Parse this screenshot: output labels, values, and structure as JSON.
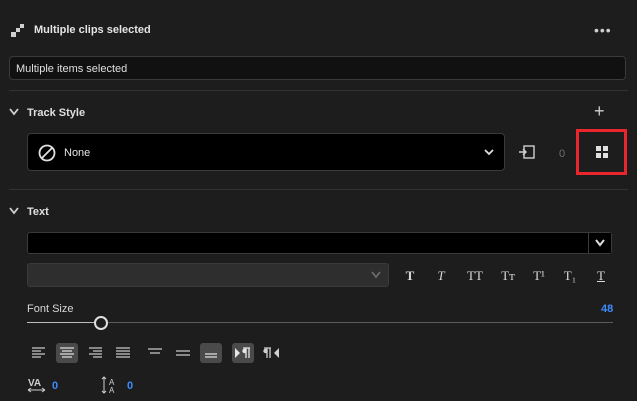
{
  "header": {
    "title": "Multiple clips selected",
    "more_label": "•••",
    "items_value": "Multiple items selected"
  },
  "track_style": {
    "title": "Track Style",
    "add_label": "+",
    "selected": "None",
    "count": "0"
  },
  "text": {
    "title": "Text",
    "font_family_value": "",
    "font_style_value": "",
    "style_buttons": [
      "T",
      "T",
      "TT",
      "Tт",
      "T¹",
      "T₁",
      "T"
    ],
    "font_size_label": "Font Size",
    "font_size_value": "48",
    "font_size_fraction": 0.126,
    "kerning_value": "0",
    "leading_value": "0"
  },
  "colors": {
    "accent": "#3d8bff",
    "highlight_box": "#e8262b",
    "background": "#1d1d1d"
  },
  "icons": [
    "clips-icon",
    "more-icon",
    "chevron-down-icon",
    "plus-icon",
    "none-icon",
    "sync-icon",
    "grid-icon",
    "align-left-icon",
    "align-center-icon",
    "align-right-icon",
    "justify-icon",
    "tracking-icon",
    "leading-icon"
  ]
}
